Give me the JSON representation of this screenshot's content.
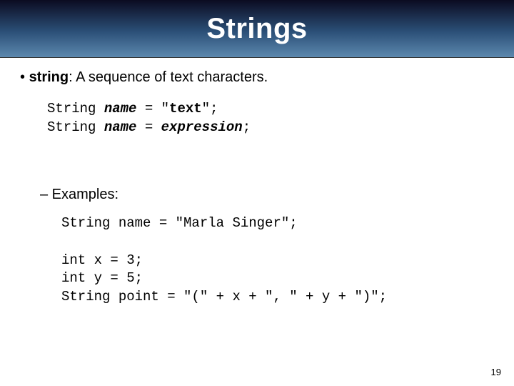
{
  "title": "Strings",
  "bullet": {
    "prefix": "• ",
    "term": "string",
    "rest": ": A sequence of text characters."
  },
  "syntax": {
    "line1": {
      "pre": "String ",
      "name": "name",
      "mid": " = \"",
      "text": "text",
      "post": "\";"
    },
    "line2": {
      "pre": "String ",
      "name": "name",
      "mid": " = ",
      "expr": "expression",
      "post": ";"
    }
  },
  "examples_label": "– Examples:",
  "examples": {
    "line1": "String name = \"Marla Singer\";",
    "blank": "",
    "line2": "int x = 3;",
    "line3": "int y = 5;",
    "line4": "String point = \"(\" + x + \", \" + y + \")\";"
  },
  "page_number": "19"
}
